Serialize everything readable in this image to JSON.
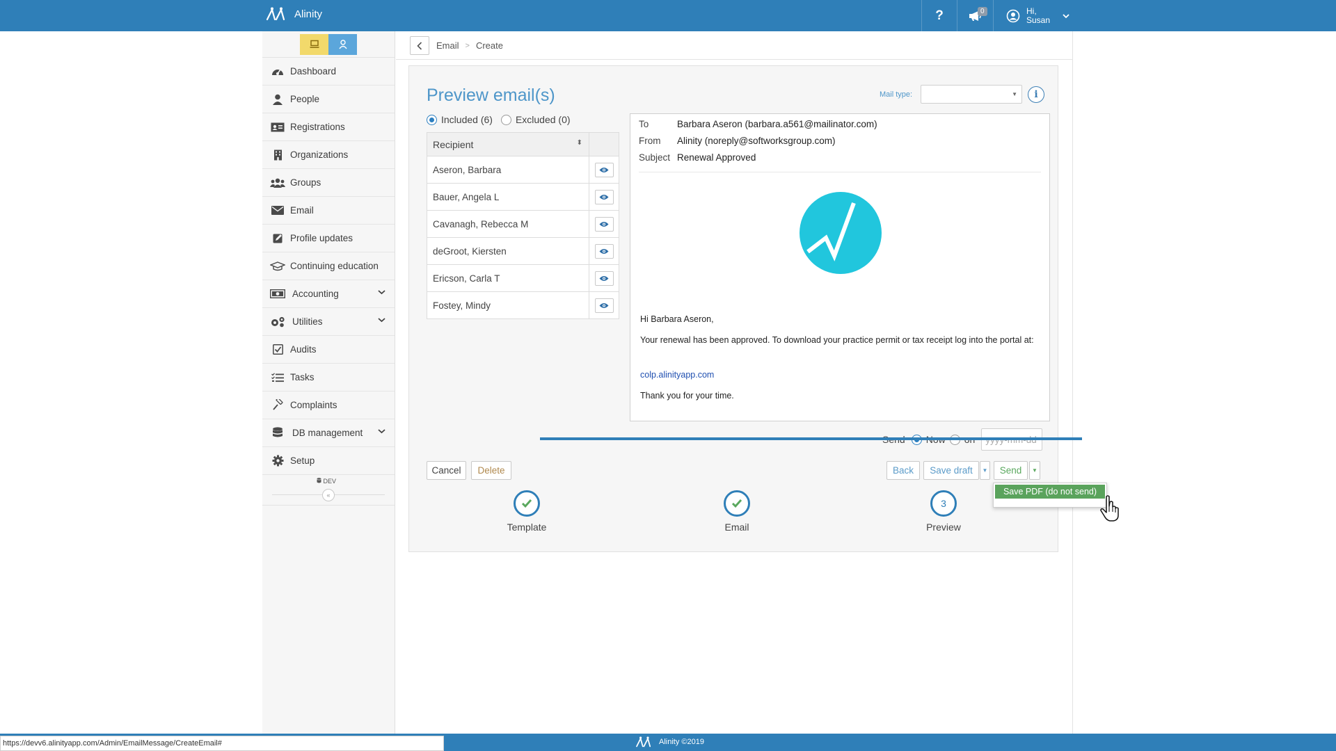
{
  "app": {
    "name": "Alinity"
  },
  "topbar": {
    "help_label": "?",
    "notification_count": "0",
    "greeting": "Hi,",
    "user_name": "Susan"
  },
  "sidebar": {
    "items": [
      {
        "label": "Dashboard",
        "icon": "dashboard-icon"
      },
      {
        "label": "People",
        "icon": "person-icon"
      },
      {
        "label": "Registrations",
        "icon": "id-card-icon"
      },
      {
        "label": "Organizations",
        "icon": "building-icon"
      },
      {
        "label": "Groups",
        "icon": "users-icon"
      },
      {
        "label": "Email",
        "icon": "envelope-icon"
      },
      {
        "label": "Profile updates",
        "icon": "edit-icon"
      },
      {
        "label": "Continuing education",
        "icon": "graduation-cap-icon"
      },
      {
        "label": "Accounting",
        "icon": "money-icon"
      },
      {
        "label": "Utilities",
        "icon": "cogs-icon"
      },
      {
        "label": "Audits",
        "icon": "checkbox-icon"
      },
      {
        "label": "Tasks",
        "icon": "list-icon"
      },
      {
        "label": "Complaints",
        "icon": "gavel-icon"
      },
      {
        "label": "DB management",
        "icon": "database-icon"
      },
      {
        "label": "Setup",
        "icon": "gear-icon"
      }
    ],
    "dev_label": "DEV"
  },
  "breadcrumb": {
    "items": [
      "Email",
      "Create"
    ]
  },
  "preview": {
    "title": "Preview email(s)",
    "mail_type_label": "Mail type:",
    "mail_type_value": "",
    "included_label": "Included (6)",
    "excluded_label": "Excluded (0)",
    "recipient_header": "Recipient",
    "recipients": [
      "Aseron, Barbara",
      "Bauer, Angela L",
      "Cavanagh, Rebecca M",
      "deGroot, Kiersten",
      "Ericson, Carla T",
      "Fostey, Mindy"
    ]
  },
  "email": {
    "to_label": "To",
    "to_value": "Barbara Aseron (barbara.a561@mailinator.com)",
    "from_label": "From",
    "from_value": "Alinity (noreply@softworksgroup.com)",
    "subject_label": "Subject",
    "subject_value": "Renewal Approved",
    "greeting": "Hi Barbara Aseron,",
    "body": "Your renewal has been approved. To download your practice permit or tax receipt log into the portal at:",
    "link": "colp.alinityapp.com",
    "closing": "Thank you for your time.",
    "brand_color": "#21c6dd"
  },
  "send": {
    "label": "Send",
    "now_label": "Now",
    "on_label": "on",
    "date_placeholder": "yyyy-mm-dd"
  },
  "buttons": {
    "cancel": "Cancel",
    "delete": "Delete",
    "back": "Back",
    "save_draft": "Save draft",
    "send": "Send",
    "save_pdf": "Save PDF (do not send)"
  },
  "steps": [
    {
      "label": "Template",
      "state": "complete"
    },
    {
      "label": "Email",
      "state": "complete"
    },
    {
      "label": "Preview",
      "state": "current",
      "number": "3"
    }
  ],
  "footer": {
    "brand": "Alinity ©2019"
  },
  "status_bar": {
    "url": "https://devv6.alinityapp.com/Admin/EmailMessage/CreateEmail#"
  },
  "colors": {
    "primary": "#2f7fb8",
    "accent": "#4e96c9",
    "success": "#5aa35c"
  }
}
